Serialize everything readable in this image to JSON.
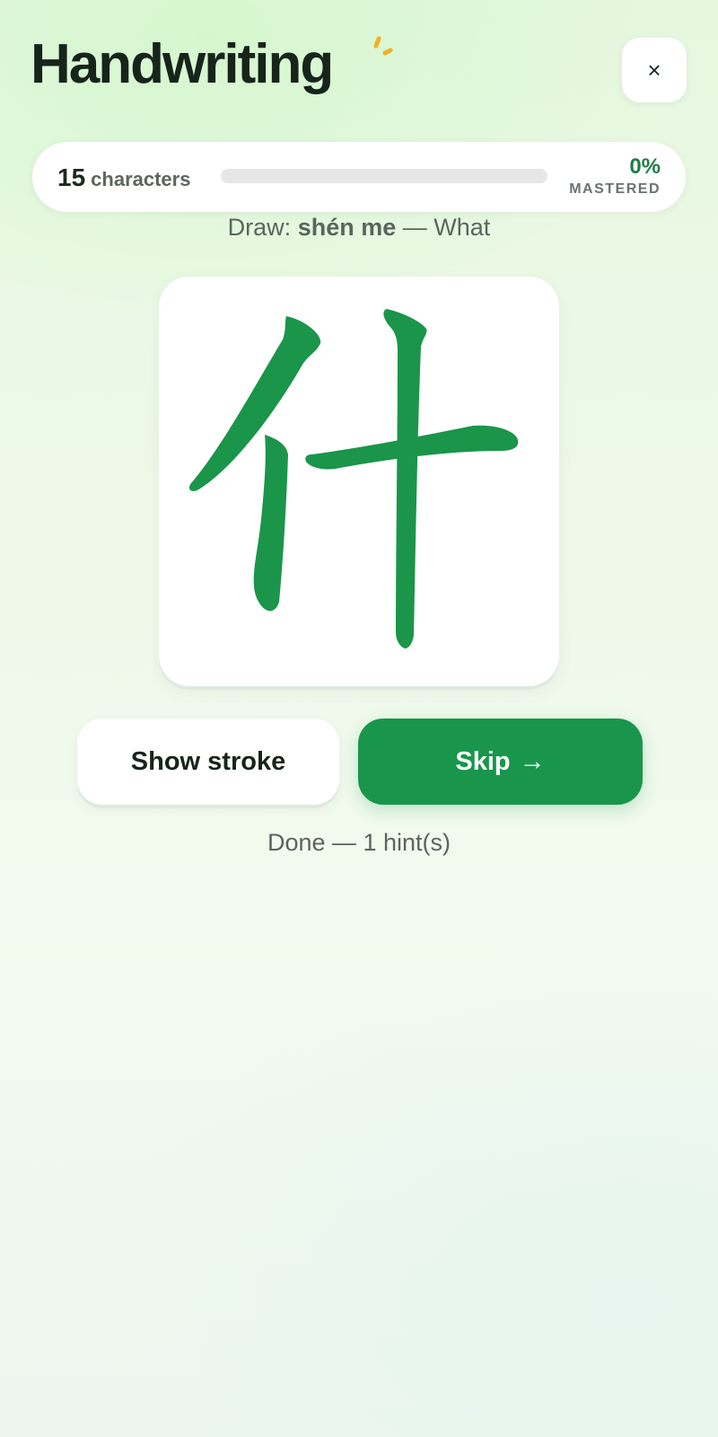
{
  "header": {
    "title": "Handwriting",
    "close_label": "×"
  },
  "progress": {
    "count": "15",
    "count_unit": "characters",
    "percent_label": "0%",
    "mastered_fraction": 0,
    "mastered_label": "MASTERED"
  },
  "prompt": {
    "prefix": "Draw:",
    "pinyin": "shén me",
    "separator": "—",
    "meaning": "What"
  },
  "character": {
    "glyph": "什",
    "color": "#1a9549"
  },
  "actions": {
    "show_stroke_label": "Show stroke",
    "skip_label": "Skip",
    "skip_arrow": "→"
  },
  "status": {
    "text": "Done — 1 hint(s)"
  },
  "colors": {
    "accent": "#19964b",
    "sparkle": "#f0b329"
  }
}
